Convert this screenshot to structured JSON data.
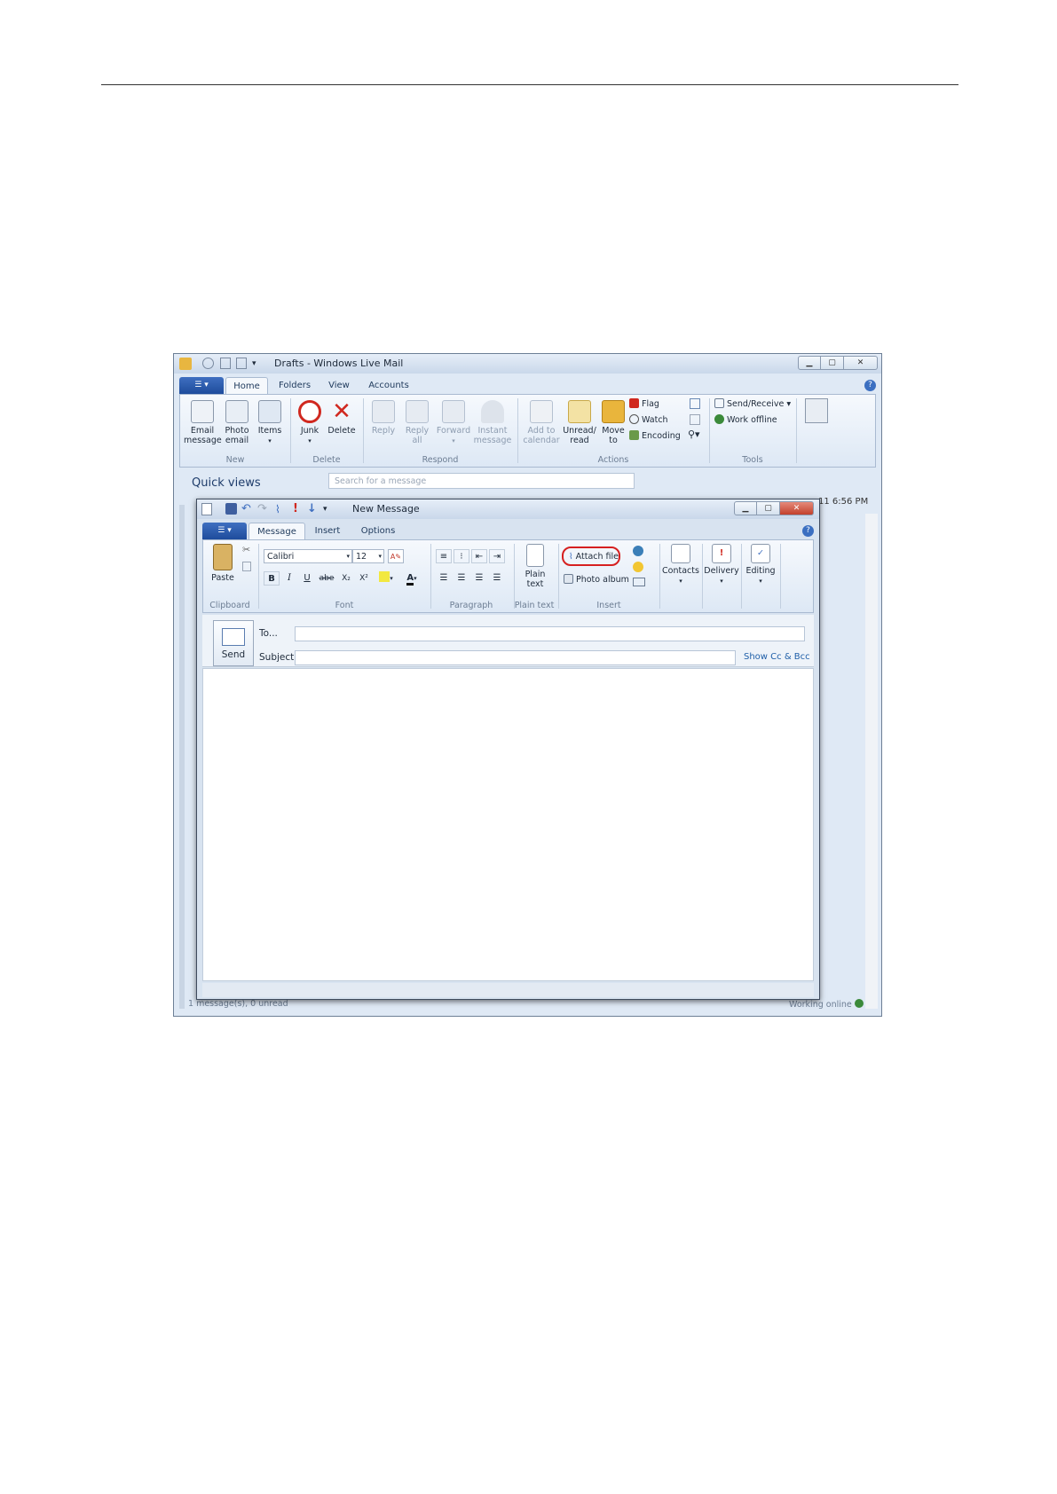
{
  "outer_window": {
    "title": "Drafts - Windows Live Mail",
    "tabs": [
      "Home",
      "Folders",
      "View",
      "Accounts"
    ],
    "active_tab": "Home",
    "ribbon": {
      "new": {
        "email_message": "Email\nmessage",
        "photo_email": "Photo\nemail",
        "items": "Items",
        "group": "New"
      },
      "delete": {
        "junk": "Junk",
        "delete": "Delete",
        "group": "Delete"
      },
      "respond": {
        "reply": "Reply",
        "reply_all": "Reply\nall",
        "forward": "Forward",
        "instant_message": "Instant\nmessage",
        "group": "Respond"
      },
      "actions": {
        "add_to_calendar": "Add to\ncalendar",
        "unread_read": "Unread/\nread",
        "move_to": "Move\nto",
        "flag": "Flag",
        "watch": "Watch",
        "encoding": "Encoding",
        "group": "Actions"
      },
      "tools": {
        "send_receive": "Send/Receive",
        "work_offline": "Work offline",
        "group": "Tools"
      }
    },
    "quick_views": "Quick views",
    "search_placeholder": "Search for a message",
    "timestamp_fragment": "11 6:56 PM",
    "status_left": "1 message(s), 0 unread",
    "status_right": "Working online"
  },
  "inner_window": {
    "title": "New Message",
    "tabs": [
      "Message",
      "Insert",
      "Options"
    ],
    "active_tab": "Message",
    "ribbon": {
      "clipboard": {
        "paste": "Paste",
        "group": "Clipboard"
      },
      "font": {
        "family": "Calibri",
        "size": "12",
        "bold": "B",
        "italic": "I",
        "underline": "U",
        "strike": "abe",
        "subscript": "X₂",
        "superscript": "X²",
        "font_color": "A",
        "group": "Font"
      },
      "paragraph": {
        "group": "Paragraph"
      },
      "plain_text": {
        "label": "Plain\ntext",
        "group": "Plain text"
      },
      "insert": {
        "attach_file": "Attach file",
        "photo_album": "Photo album",
        "group": "Insert"
      },
      "contacts": "Contacts",
      "delivery": "Delivery",
      "editing": "Editing"
    },
    "compose": {
      "send": "Send",
      "to_label": "To...",
      "subject_label": "Subject",
      "show_cc_bcc": "Show Cc & Bcc"
    }
  },
  "colors": {
    "highlight_ring": "#d62020",
    "file_button": "#2a5aae",
    "link": "#1f5fa8"
  }
}
